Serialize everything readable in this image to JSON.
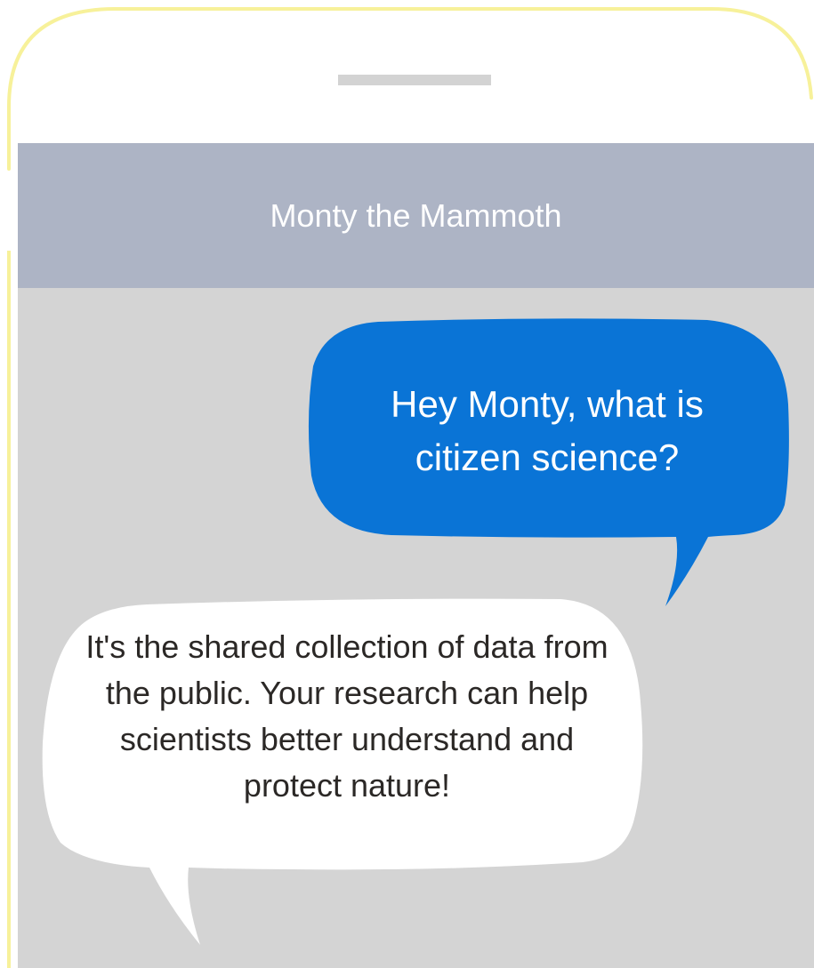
{
  "header": {
    "title": "Monty the Mammoth"
  },
  "messages": [
    {
      "direction": "outgoing",
      "text": "Hey Monty, what is citizen science?",
      "bubble_color": "#0a74d6",
      "text_color": "#ffffff"
    },
    {
      "direction": "incoming",
      "text": "It's the shared collection of data from the public. Your research can help scientists better understand and protect nature!",
      "bubble_color": "#ffffff",
      "text_color": "#2b2826"
    }
  ],
  "colors": {
    "phone_outline": "#f7f19a",
    "header_bg": "#adb4c5",
    "chat_bg": "#d4d4d4",
    "speaker": "#d3d3d3"
  }
}
